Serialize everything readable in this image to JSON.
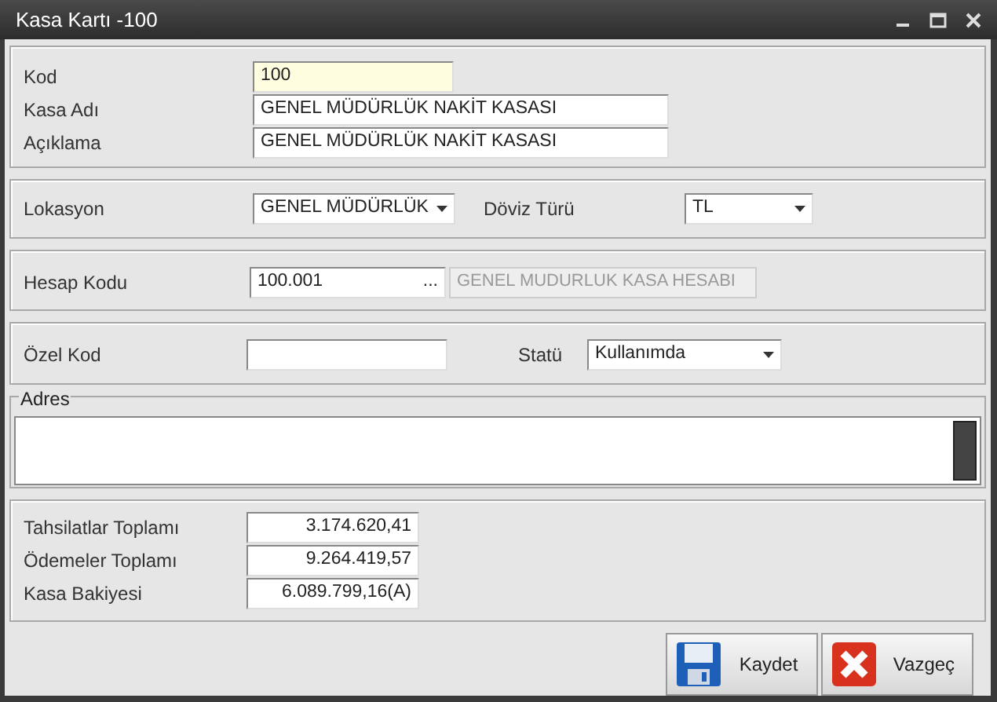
{
  "window": {
    "title": "Kasa Kartı -100"
  },
  "general": [
    {
      "label": "Kod",
      "value": "100",
      "focused": true
    },
    {
      "label": "Kasa Adı",
      "value": "GENEL MÜDÜRLÜK NAKİT KASASI",
      "focused": false
    },
    {
      "label": "Açıklama",
      "value": "GENEL MÜDÜRLÜK NAKİT KASASI",
      "focused": false
    }
  ],
  "location": {
    "lokasyon": {
      "label": "Lokasyon",
      "value": "GENEL MÜDÜRLÜK"
    },
    "doviz": {
      "label": "Döviz Türü",
      "value": "TL"
    }
  },
  "account": {
    "label": "Hesap Kodu",
    "value": "100.001",
    "lookup_button": "...",
    "description": "GENEL MUDURLUK KASA HESABI"
  },
  "special": {
    "ozel_kod": {
      "label": "Özel Kod"
    },
    "statu": {
      "label": "Statü",
      "value": "Kullanımda"
    }
  },
  "address": {
    "legend": "Adres"
  },
  "totals": [
    {
      "label": "Tahsilatlar Toplamı",
      "value": "3.174.620,41"
    },
    {
      "label": "Ödemeler Toplamı",
      "value": "9.264.419,57"
    },
    {
      "label": "Kasa Bakiyesi",
      "value": "6.089.799,16(A)"
    }
  ],
  "buttons": [
    {
      "label": "Kaydet",
      "kind": "save"
    },
    {
      "label": "Vazgeç",
      "kind": "cancel"
    }
  ]
}
